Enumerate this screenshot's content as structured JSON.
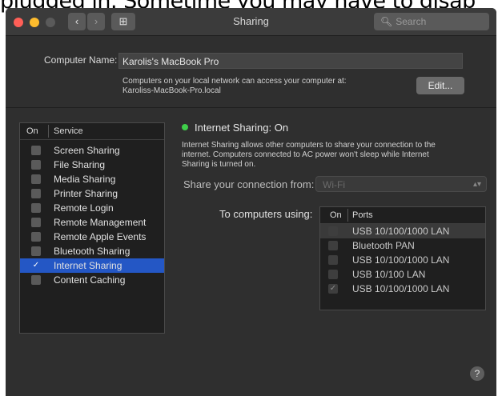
{
  "overlay_text": "plugged in. Sometime you may have to disab",
  "window": {
    "title": "Sharing",
    "nav": {
      "back": "‹",
      "forward": "›",
      "grid": "⊞"
    },
    "search_placeholder": "Search"
  },
  "computer_name": {
    "label": "Computer Name:",
    "value": "Karolis's MacBook Pro",
    "info_line1": "Computers on your local network can access your computer at:",
    "info_line2": "Karoliss-MacBook-Pro.local",
    "edit_label": "Edit..."
  },
  "services": {
    "header_on": "On",
    "header_service": "Service",
    "items": [
      {
        "label": "Screen Sharing",
        "checked": false
      },
      {
        "label": "File Sharing",
        "checked": false
      },
      {
        "label": "Media Sharing",
        "checked": false
      },
      {
        "label": "Printer Sharing",
        "checked": false
      },
      {
        "label": "Remote Login",
        "checked": false
      },
      {
        "label": "Remote Management",
        "checked": false
      },
      {
        "label": "Remote Apple Events",
        "checked": false
      },
      {
        "label": "Bluetooth Sharing",
        "checked": false
      },
      {
        "label": "Internet Sharing",
        "checked": true
      },
      {
        "label": "Content Caching",
        "checked": false
      }
    ]
  },
  "detail": {
    "status": "Internet Sharing: On",
    "status_color": "#3fcf4a",
    "description_line1": "Internet Sharing allows other computers to share your connection to the",
    "description_line2": "internet. Computers connected to AC power won't sleep while Internet",
    "description_line3": "Sharing is turned on.",
    "share_from_label": "Share your connection from:",
    "share_from_value": "Wi-Fi",
    "to_computers_label": "To computers using:",
    "ports_header_on": "On",
    "ports_header_ports": "Ports",
    "ports": [
      {
        "label": "USB 10/100/1000 LAN",
        "checked": false
      },
      {
        "label": "Bluetooth PAN",
        "checked": false
      },
      {
        "label": "USB 10/100/1000 LAN",
        "checked": false
      },
      {
        "label": "USB 10/100 LAN",
        "checked": false
      },
      {
        "label": "USB 10/100/1000 LAN",
        "checked": true
      }
    ]
  },
  "help_label": "?",
  "colors": {
    "selection": "#2457c5",
    "window_bg": "#2f2f2f"
  }
}
